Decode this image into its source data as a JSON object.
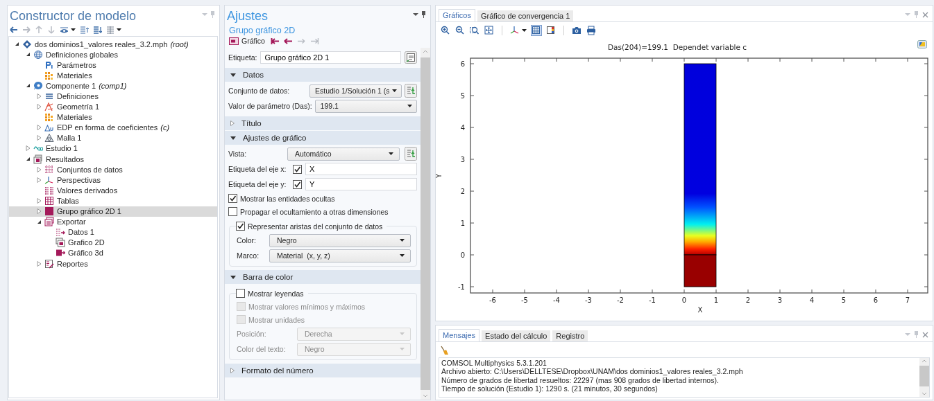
{
  "model_builder": {
    "title": "Constructor de modelo",
    "tree": [
      {
        "label": "dos dominios1_valores reales_3.2.mph",
        "note": "(root)",
        "kind": "model",
        "expanded": true,
        "selected": false,
        "children": [
          {
            "label": "Definiciones globales",
            "kind": "globe",
            "expanded": true,
            "selected": false,
            "children": [
              {
                "label": "Parámetros",
                "kind": "param",
                "selected": false
              },
              {
                "label": "Materiales",
                "kind": "materials",
                "selected": false
              }
            ]
          },
          {
            "label": "Componente 1",
            "note": "(comp1)",
            "kind": "component",
            "expanded": true,
            "selected": false,
            "children": [
              {
                "label": "Definiciones",
                "kind": "list",
                "expanded": false,
                "selected": false
              },
              {
                "label": "Geometría 1",
                "kind": "geometry",
                "expanded": false,
                "selected": false
              },
              {
                "label": "Materiales",
                "kind": "materials",
                "selected": false
              },
              {
                "label": "EDP en forma de coeficientes",
                "note": "(c)",
                "kind": "pde",
                "expanded": false,
                "selected": false
              },
              {
                "label": "Malla 1",
                "kind": "mesh",
                "expanded": false,
                "selected": false
              }
            ]
          },
          {
            "label": "Estudio 1",
            "kind": "study",
            "expanded": false,
            "selected": false
          },
          {
            "label": "Resultados",
            "kind": "results",
            "expanded": true,
            "selected": false,
            "children": [
              {
                "label": "Conjuntos de datos",
                "kind": "datasets",
                "expanded": false,
                "selected": false
              },
              {
                "label": "Perspectivas",
                "kind": "views",
                "expanded": false,
                "selected": false
              },
              {
                "label": "Valores derivados",
                "kind": "derived",
                "selected": false
              },
              {
                "label": "Tablas",
                "kind": "tables",
                "expanded": false,
                "selected": false
              },
              {
                "label": "Grupo gráfico 2D 1",
                "kind": "plotgroup",
                "expanded": false,
                "selected": true
              },
              {
                "label": "Exportar",
                "kind": "export",
                "expanded": true,
                "selected": false,
                "children": [
                  {
                    "label": "Datos 1",
                    "kind": "data",
                    "selected": false
                  },
                  {
                    "label": "Grafico 2D",
                    "kind": "plot2d",
                    "selected": false
                  },
                  {
                    "label": "Gráfico 3d",
                    "kind": "plot3d",
                    "selected": false
                  }
                ]
              },
              {
                "label": "Reportes",
                "kind": "reports",
                "expanded": false,
                "selected": false
              }
            ]
          }
        ]
      }
    ]
  },
  "settings": {
    "title": "Ajustes",
    "subtitle": "Grupo gráfico 2D",
    "node_label": "Gráfico",
    "nav": [
      {
        "kind": "first",
        "disabled": false
      },
      {
        "kind": "prev",
        "disabled": false
      },
      {
        "kind": "next",
        "disabled": true
      },
      {
        "kind": "last",
        "disabled": true
      }
    ],
    "label_field": {
      "label": "Etiqueta:",
      "value": "Grupo gráfico 2D 1"
    },
    "sections": [
      {
        "title": "Datos",
        "expanded": true,
        "rows": [
          {
            "kind": "select",
            "label": "Conjunto de datos:",
            "value": "Estudio 1/Solución 1 (s",
            "button": true,
            "disabled": false
          },
          {
            "kind": "select",
            "label": "Valor de parámetro (Das):",
            "value": "199.1",
            "disabled": false
          }
        ]
      },
      {
        "title": "Título",
        "expanded": false
      },
      {
        "title": "Ajustes de gráfico",
        "expanded": true,
        "rows": [
          {
            "kind": "select",
            "label": "Vista:",
            "value": "Automático",
            "button": true,
            "disabled": false
          },
          {
            "kind": "axis",
            "label": "Etiqueta del eje x:",
            "checked": true,
            "value": "X"
          },
          {
            "kind": "axis",
            "label": "Etiqueta del eje y:",
            "checked": true,
            "value": "Y"
          },
          {
            "kind": "check",
            "label": "Mostrar las entidades ocultas",
            "checked": true,
            "disabled": false
          },
          {
            "kind": "check",
            "label": "Propagar el ocultamiento a otras dimensiones",
            "checked": false,
            "disabled": false
          },
          {
            "kind": "group",
            "legend": {
              "label": "Representar aristas del conjunto de datos",
              "checked": true
            },
            "rows": [
              {
                "kind": "select",
                "label": "Color:",
                "value": "Negro",
                "disabled": false
              },
              {
                "kind": "select",
                "label": "Marco:",
                "value": "Material  (x, y, z)",
                "disabled": false
              }
            ]
          }
        ]
      },
      {
        "title": "Barra de color",
        "expanded": true,
        "rows": [
          {
            "kind": "group",
            "legend": {
              "label": "Mostrar leyendas",
              "checked": false
            },
            "rows": [
              {
                "kind": "check",
                "label": "Mostrar valores mínimos y máximos",
                "checked": false,
                "disabled": true
              },
              {
                "kind": "check",
                "label": "Mostrar unidades",
                "checked": false,
                "disabled": true
              },
              {
                "kind": "select",
                "label": "Posición:",
                "value": "Derecha",
                "disabled": true
              },
              {
                "kind": "select",
                "label": "Color del texto:",
                "value": "Negro",
                "disabled": true
              }
            ]
          }
        ]
      },
      {
        "title": "Formato del número",
        "expanded": false
      }
    ]
  },
  "graphics": {
    "tabs": [
      {
        "label": "Gráficos",
        "selected": true
      },
      {
        "label": "Gráfico de convergencia 1",
        "selected": false
      }
    ],
    "toolbar": [
      {
        "kind": "zoom-in",
        "on": false
      },
      {
        "kind": "zoom-out",
        "on": false
      },
      {
        "kind": "zoom-box",
        "on": false
      },
      {
        "kind": "zoom-extents",
        "on": false
      },
      {
        "kind": "axes",
        "on": false
      },
      {
        "kind": "grid",
        "on": true
      },
      {
        "kind": "colorbar",
        "on": false
      },
      {
        "kind": "camera",
        "on": false
      },
      {
        "kind": "print",
        "on": false
      }
    ],
    "plot": {
      "title": "Das(204)=199.1  Dependet variable c",
      "xlabel": "X",
      "ylabel": "Y",
      "xticks": [
        "-6",
        "-5",
        "-4",
        "-3",
        "-2",
        "-1",
        "0",
        "1",
        "2",
        "3",
        "4",
        "5",
        "6",
        "7"
      ],
      "yticks": [
        "6",
        "5",
        "4",
        "3",
        "2",
        "1",
        "0",
        "-1"
      ]
    }
  },
  "messages": {
    "tabs": [
      {
        "label": "Mensajes",
        "selected": true
      },
      {
        "label": "Estado del cálculo",
        "selected": false
      },
      {
        "label": "Registro",
        "selected": false
      }
    ],
    "lines": [
      "COMSOL Multiphysics 5.3.1.201",
      "Archivo abierto: C:\\Users\\DELLTESE\\Dropbox\\UNAM\\dos dominios1_valores reales_3.2.mph",
      "Número de grados de libertad resueltos: 22297 (mas 908 grados de libertad internos).",
      "Tiempo de solución (Estudio 1): 1290 s. (21 minutos, 30 segundos)"
    ]
  }
}
